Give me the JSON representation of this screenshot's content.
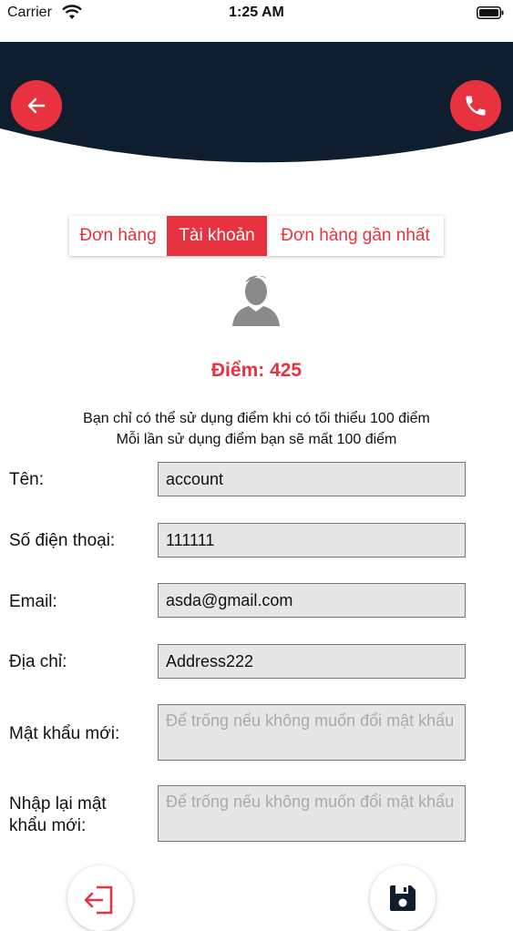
{
  "status_bar": {
    "carrier": "Carrier",
    "time": "1:25 AM"
  },
  "header": {
    "background_color": "#0f1e2e",
    "accent_color": "#e8323f"
  },
  "tabs": [
    {
      "label": "Đơn hàng",
      "active": false
    },
    {
      "label": "Tài khoản",
      "active": true
    },
    {
      "label": "Đơn hàng gần nhất",
      "active": false
    }
  ],
  "profile": {
    "points_label": "Điểm: 425"
  },
  "notes": [
    "Bạn chỉ có thể sử dụng điểm khi có tối thiểu 100 điểm",
    "Mỗi lần sử dụng điểm bạn sẽ mất 100 điểm"
  ],
  "form": {
    "name": {
      "label": "Tên:",
      "value": "account"
    },
    "phone": {
      "label": "Số điện thoại:",
      "value": "111111"
    },
    "email": {
      "label": "Email:",
      "value": "asda@gmail.com"
    },
    "address": {
      "label": "Địa chỉ:",
      "value": "Address222"
    },
    "new_password": {
      "label": "Mật khẩu mới:",
      "placeholder": "Để trống nếu không muốn đổi mật khẩu"
    },
    "confirm_password": {
      "label": "Nhập lại mật khẩu mới:",
      "placeholder": "Để trống nếu không muốn đổi mật khẩu"
    }
  },
  "icons": {
    "back": "arrow-left-icon",
    "call": "phone-icon",
    "avatar": "user-silhouette-icon",
    "logout": "logout-icon",
    "save": "floppy-disk-icon"
  }
}
